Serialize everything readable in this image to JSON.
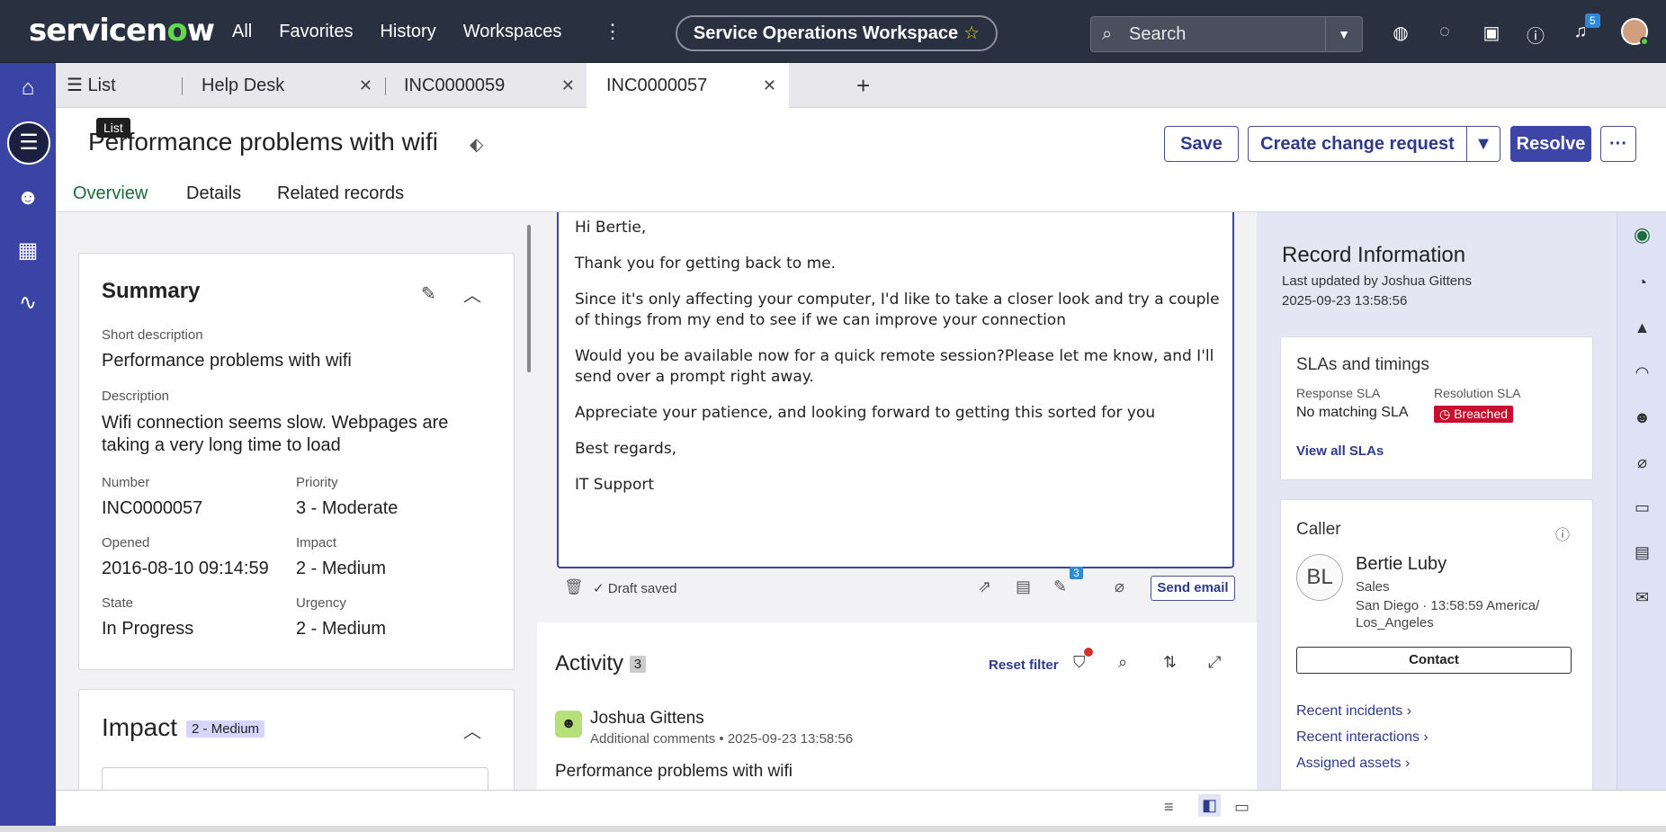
{
  "topbar": {
    "logo": "servicenow",
    "nav": [
      "All",
      "Favorites",
      "History",
      "Workspaces"
    ],
    "workspace_name": "Service Operations Workspace",
    "search_placeholder": "Search",
    "notification_count": "5"
  },
  "tabs": [
    {
      "label": "List"
    },
    {
      "label": "Help Desk"
    },
    {
      "label": "INC0000059"
    },
    {
      "label": "INC0000057"
    }
  ],
  "tooltip": "List",
  "header": {
    "title": "Performance problems with wifi",
    "save": "Save",
    "create_change": "Create change request",
    "resolve": "Resolve"
  },
  "subtabs": [
    "Overview",
    "Details",
    "Related records"
  ],
  "summary": {
    "title": "Summary",
    "short_description_label": "Short description",
    "short_description": "Performance problems with wifi",
    "description_label": "Description",
    "description": "Wifi connection seems slow. Webpages are taking a very long time to load",
    "number_label": "Number",
    "number": "INC0000057",
    "priority_label": "Priority",
    "priority": "3 - Moderate",
    "opened_label": "Opened",
    "opened": "2016-08-10 09:14:59",
    "impact_label": "Impact",
    "impact": "2 - Medium",
    "state_label": "State",
    "state": "In Progress",
    "urgency_label": "Urgency",
    "urgency": "2 - Medium"
  },
  "impact_card": {
    "title": "Impact",
    "pill": "2 - Medium"
  },
  "composer": {
    "lines": [
      "Hi Bertie,",
      "Thank you for getting back to me.",
      "Since it's only affecting your computer, I'd like to take a closer look and try a couple of things from my end to see if we can improve your connection",
      "Would you be available now for a quick remote session?Please let me know, and I'll send over a prompt right away.",
      "Appreciate your patience, and looking forward to getting this sorted for you",
      "Best regards,",
      "IT Support"
    ],
    "draft_status": "Draft saved",
    "template_count": "3",
    "send": "Send email"
  },
  "activity": {
    "title": "Activity",
    "count": "3",
    "reset_filter": "Reset filter",
    "entry_author": "Joshua Gittens",
    "entry_meta": "Additional comments • 2025-09-23 13:58:56",
    "entry_text": "Performance problems with wifi"
  },
  "record_info": {
    "title": "Record Information",
    "updated_by": "Last updated by Joshua Gittens",
    "updated_at": "2025-09-23 13:58:56"
  },
  "sla": {
    "title": "SLAs and timings",
    "response_label": "Response SLA",
    "response_value": "No matching SLA",
    "resolution_label": "Resolution SLA",
    "resolution_value": "Breached",
    "view_all": "View all SLAs"
  },
  "caller": {
    "title": "Caller",
    "initials": "BL",
    "name": "Bertie Luby",
    "department": "Sales",
    "location": "San Diego · 13:58:59 America/ Los_Angeles",
    "contact": "Contact",
    "links": [
      "Recent incidents",
      "Recent interactions",
      "Assigned assets"
    ]
  },
  "colors": {
    "topbar": "#293040",
    "accent": "#3d46a6",
    "active_tab": "#1c6b3a",
    "breached": "#c8102e"
  }
}
